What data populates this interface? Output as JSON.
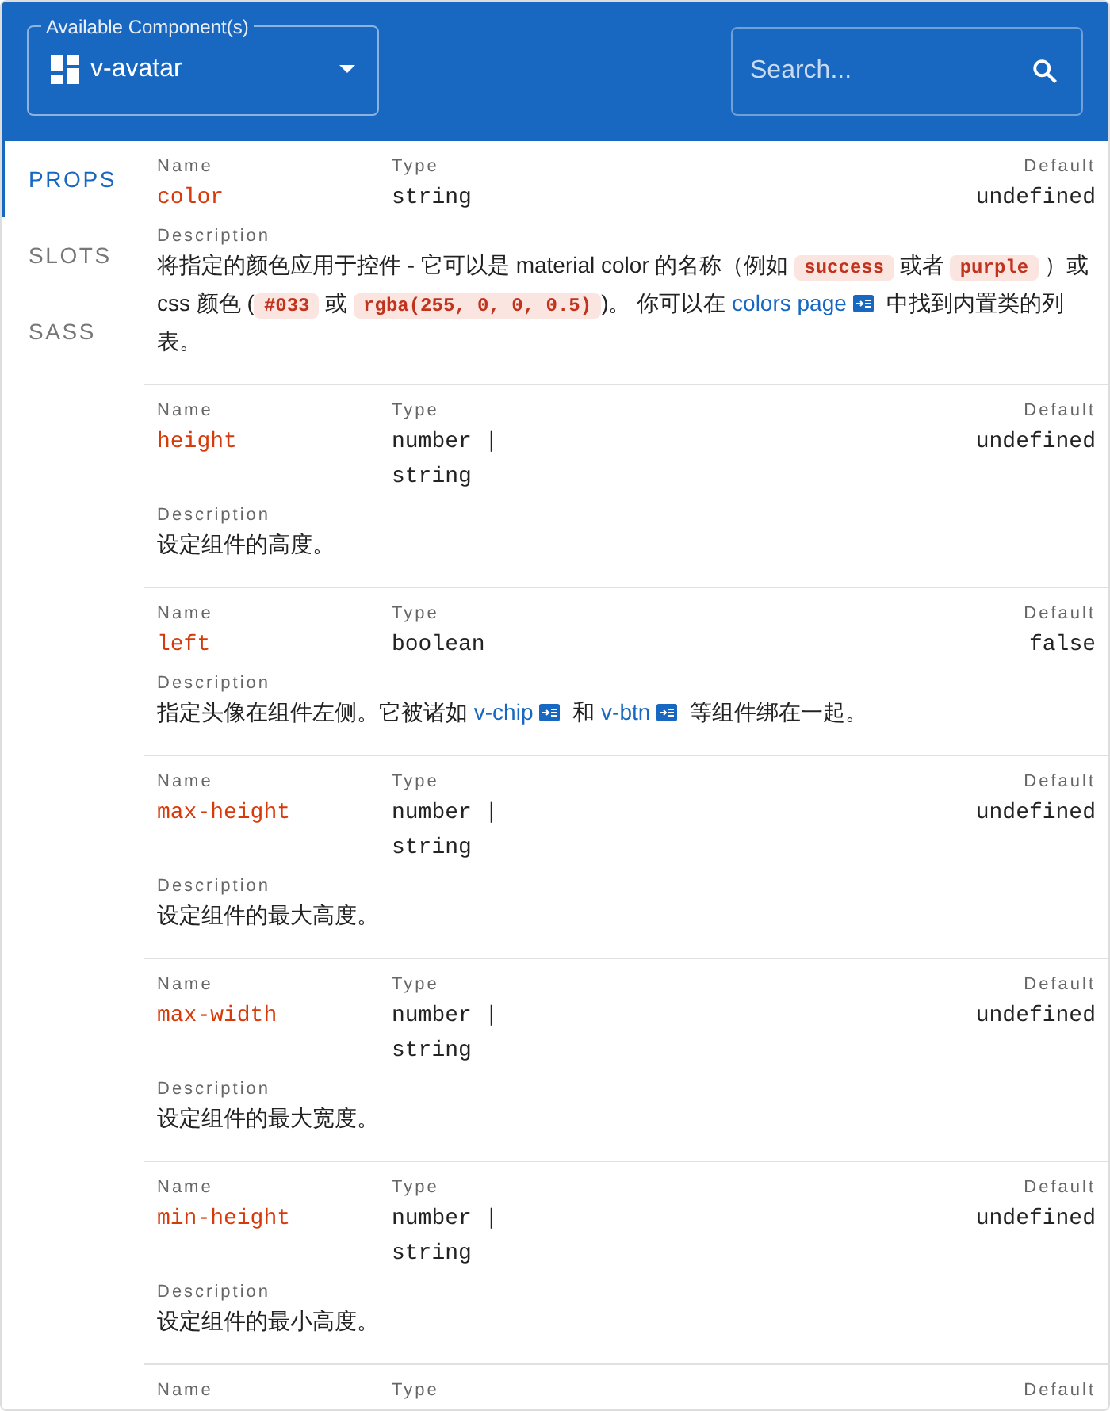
{
  "component_select": {
    "label": "Available Component(s)",
    "value": "v-avatar"
  },
  "search": {
    "placeholder": "Search..."
  },
  "tabs": [
    {
      "label": "PROPS",
      "selected": true
    },
    {
      "label": "SLOTS",
      "selected": false
    },
    {
      "label": "SASS",
      "selected": false
    }
  ],
  "rows": [
    {
      "labels": {
        "name": "Name",
        "type": "Type",
        "default": "Default",
        "description": "Description"
      },
      "name": "color",
      "type": "string",
      "default": "undefined",
      "description": [
        {
          "kind": "text",
          "text": "将指定的颜色应用于控件 - 它可以是 material color 的名称（例如 "
        },
        {
          "kind": "code",
          "text": "success"
        },
        {
          "kind": "text",
          "text": " 或者 "
        },
        {
          "kind": "code",
          "text": "purple"
        },
        {
          "kind": "text",
          "text": " ）或 css 颜色 ("
        },
        {
          "kind": "code",
          "text": "#033"
        },
        {
          "kind": "text",
          "text": " 或 "
        },
        {
          "kind": "code",
          "text": "rgba(255, 0, 0, 0.5)"
        },
        {
          "kind": "text",
          "text": ")。 你可以在 "
        },
        {
          "kind": "link",
          "text": "colors page"
        },
        {
          "kind": "text",
          "text": " 中找到内置类的列表。"
        }
      ]
    },
    {
      "labels": {
        "name": "Name",
        "type": "Type",
        "default": "Default",
        "description": "Description"
      },
      "name": "height",
      "type": "number | string",
      "default": "undefined",
      "description": [
        {
          "kind": "text",
          "text": "设定组件的高度。"
        }
      ]
    },
    {
      "labels": {
        "name": "Name",
        "type": "Type",
        "default": "Default",
        "description": "Description"
      },
      "name": "left",
      "type": "boolean",
      "default": "false",
      "description": [
        {
          "kind": "text",
          "text": "指定头像在组件左侧。它被诸如 "
        },
        {
          "kind": "link",
          "text": "v-chip"
        },
        {
          "kind": "text",
          "text": " 和 "
        },
        {
          "kind": "link",
          "text": "v-btn"
        },
        {
          "kind": "text",
          "text": " 等组件绑在一起。"
        }
      ]
    },
    {
      "labels": {
        "name": "Name",
        "type": "Type",
        "default": "Default",
        "description": "Description"
      },
      "name": "max-height",
      "type": "number | string",
      "default": "undefined",
      "description": [
        {
          "kind": "text",
          "text": "设定组件的最大高度。"
        }
      ]
    },
    {
      "labels": {
        "name": "Name",
        "type": "Type",
        "default": "Default",
        "description": "Description"
      },
      "name": "max-width",
      "type": "number | string",
      "default": "undefined",
      "description": [
        {
          "kind": "text",
          "text": "设定组件的最大宽度。"
        }
      ]
    },
    {
      "labels": {
        "name": "Name",
        "type": "Type",
        "default": "Default",
        "description": "Description"
      },
      "name": "min-height",
      "type": "number | string",
      "default": "undefined",
      "description": [
        {
          "kind": "text",
          "text": "设定组件的最小高度。"
        }
      ]
    },
    {
      "labels": {
        "name": "Name",
        "type": "Type",
        "default": "Default"
      }
    }
  ]
}
